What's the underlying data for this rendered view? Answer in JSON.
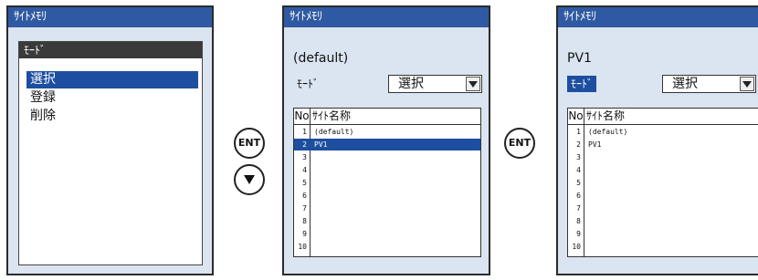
{
  "screens": [
    {
      "title": "ｻｲﾄﾒﾓﾘ",
      "menu": {
        "header": "ﾓｰﾄﾞ",
        "items": [
          "選択",
          "登録",
          "削除"
        ],
        "selected_index": 0
      }
    },
    {
      "title": "ｻｲﾄﾒﾓﾘ",
      "site_label": "(default)",
      "mode_label": "ﾓｰﾄﾞ",
      "mode_value": "選択",
      "table": {
        "col_no": "No",
        "col_name": "ｻｲﾄ名称",
        "rows": [
          {
            "no": "1",
            "name": "(default)"
          },
          {
            "no": "2",
            "name": "PV1"
          },
          {
            "no": "3",
            "name": ""
          },
          {
            "no": "4",
            "name": ""
          },
          {
            "no": "5",
            "name": ""
          },
          {
            "no": "6",
            "name": ""
          },
          {
            "no": "7",
            "name": ""
          },
          {
            "no": "8",
            "name": ""
          },
          {
            "no": "9",
            "name": ""
          },
          {
            "no": "10",
            "name": ""
          }
        ],
        "selected_row": 2
      }
    },
    {
      "title": "ｻｲﾄﾒﾓﾘ",
      "site_label": "PV1",
      "mode_label": "ﾓｰﾄﾞ",
      "mode_value": "選択",
      "table": {
        "col_no": "No",
        "col_name": "ｻｲﾄ名称",
        "rows": [
          {
            "no": "1",
            "name": "(default)"
          },
          {
            "no": "2",
            "name": "PV1"
          },
          {
            "no": "3",
            "name": ""
          },
          {
            "no": "4",
            "name": ""
          },
          {
            "no": "5",
            "name": ""
          },
          {
            "no": "6",
            "name": ""
          },
          {
            "no": "7",
            "name": ""
          },
          {
            "no": "8",
            "name": ""
          },
          {
            "no": "9",
            "name": ""
          },
          {
            "no": "10",
            "name": ""
          }
        ]
      }
    }
  ],
  "keys": {
    "ent1": "ENT",
    "down": "down-arrow-icon",
    "ent2": "ENT"
  }
}
